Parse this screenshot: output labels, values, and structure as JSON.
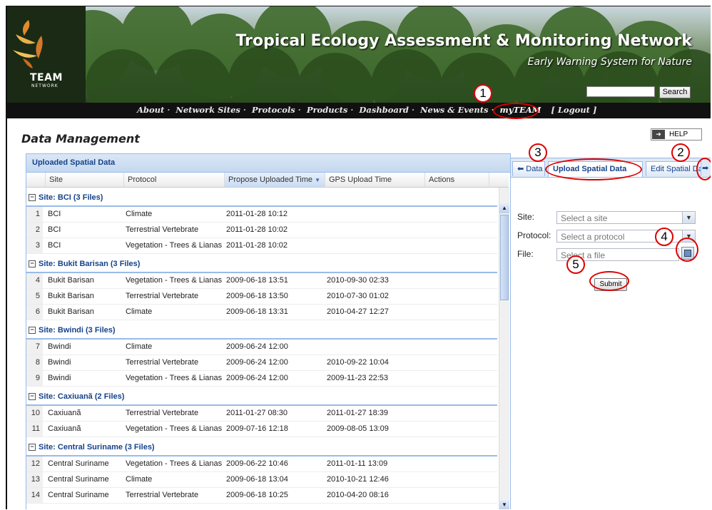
{
  "header": {
    "logo_text": "TEAM",
    "logo_sub": "NETWORK",
    "title": "Tropical Ecology Assessment & Monitoring Network",
    "subtitle": "Early Warning System for Nature",
    "search_label": "Search",
    "nav": [
      "About",
      "Network Sites",
      "Protocols",
      "Products",
      "Dashboard",
      "News & Events",
      "myTEAM"
    ],
    "logout": "[ Logout ]"
  },
  "page": {
    "title": "Data Management",
    "help_label": "HELP"
  },
  "grid": {
    "title": "Uploaded Spatial Data",
    "columns": [
      "Site",
      "Protocol",
      "Propose Uploaded Time",
      "GPS Upload Time",
      "Actions"
    ],
    "groups": [
      {
        "label": "Site: BCI (3 Files)",
        "rows": [
          {
            "n": "1",
            "site": "BCI",
            "protocol": "Climate",
            "proposed": "2011-01-28 10:12",
            "gps": "",
            "delete": true
          },
          {
            "n": "2",
            "site": "BCI",
            "protocol": "Terrestrial Vertebrate",
            "proposed": "2011-01-28 10:02",
            "gps": "",
            "delete": true
          },
          {
            "n": "3",
            "site": "BCI",
            "protocol": "Vegetation - Trees & Lianas",
            "proposed": "2011-01-28 10:02",
            "gps": "",
            "delete": true
          }
        ]
      },
      {
        "label": "Site: Bukit Barisan (3 Files)",
        "rows": [
          {
            "n": "4",
            "site": "Bukit Barisan",
            "protocol": "Vegetation - Trees & Lianas",
            "proposed": "2009-06-18 13:51",
            "gps": "2010-09-30 02:33",
            "delete": false
          },
          {
            "n": "5",
            "site": "Bukit Barisan",
            "protocol": "Terrestrial Vertebrate",
            "proposed": "2009-06-18 13:50",
            "gps": "2010-07-30 01:02",
            "delete": false
          },
          {
            "n": "6",
            "site": "Bukit Barisan",
            "protocol": "Climate",
            "proposed": "2009-06-18 13:31",
            "gps": "2010-04-27 12:27",
            "delete": false
          }
        ]
      },
      {
        "label": "Site: Bwindi (3 Files)",
        "rows": [
          {
            "n": "7",
            "site": "Bwindi",
            "protocol": "Climate",
            "proposed": "2009-06-24 12:00",
            "gps": "",
            "delete": true
          },
          {
            "n": "8",
            "site": "Bwindi",
            "protocol": "Terrestrial Vertebrate",
            "proposed": "2009-06-24 12:00",
            "gps": "2010-09-22 10:04",
            "delete": false
          },
          {
            "n": "9",
            "site": "Bwindi",
            "protocol": "Vegetation - Trees & Lianas",
            "proposed": "2009-06-24 12:00",
            "gps": "2009-11-23 22:53",
            "delete": false
          }
        ]
      },
      {
        "label": "Site: Caxiuanã (2 Files)",
        "rows": [
          {
            "n": "10",
            "site": "Caxiuanã",
            "protocol": "Terrestrial Vertebrate",
            "proposed": "2011-01-27 08:30",
            "gps": "2011-01-27 18:39",
            "delete": false
          },
          {
            "n": "11",
            "site": "Caxiuanã",
            "protocol": "Vegetation - Trees & Lianas",
            "proposed": "2009-07-16 12:18",
            "gps": "2009-08-05 13:09",
            "delete": false
          }
        ]
      },
      {
        "label": "Site: Central Suriname (3 Files)",
        "rows": [
          {
            "n": "12",
            "site": "Central Suriname",
            "protocol": "Vegetation - Trees & Lianas",
            "proposed": "2009-06-22 10:46",
            "gps": "2011-01-11 13:09",
            "delete": false
          },
          {
            "n": "13",
            "site": "Central Suriname",
            "protocol": "Climate",
            "proposed": "2009-06-18 13:04",
            "gps": "2010-10-21 12:46",
            "delete": false
          },
          {
            "n": "14",
            "site": "Central Suriname",
            "protocol": "Terrestrial Vertebrate",
            "proposed": "2009-06-18 10:25",
            "gps": "2010-04-20 08:16",
            "delete": false
          }
        ]
      }
    ]
  },
  "tabs": [
    "Data",
    "Upload Spatial Data",
    "Edit Spatial Da"
  ],
  "form": {
    "site_label": "Site:",
    "site_placeholder": "Select a site",
    "protocol_label": "Protocol:",
    "protocol_placeholder": "Select a protocol",
    "file_label": "File:",
    "file_placeholder": "Select a file",
    "submit_label": "Submit"
  },
  "annotations": [
    "1",
    "2",
    "3",
    "4",
    "5"
  ],
  "colors": {
    "accent": "#15428b",
    "annotation": "#dd0000",
    "panel_border": "#99bbe8"
  }
}
